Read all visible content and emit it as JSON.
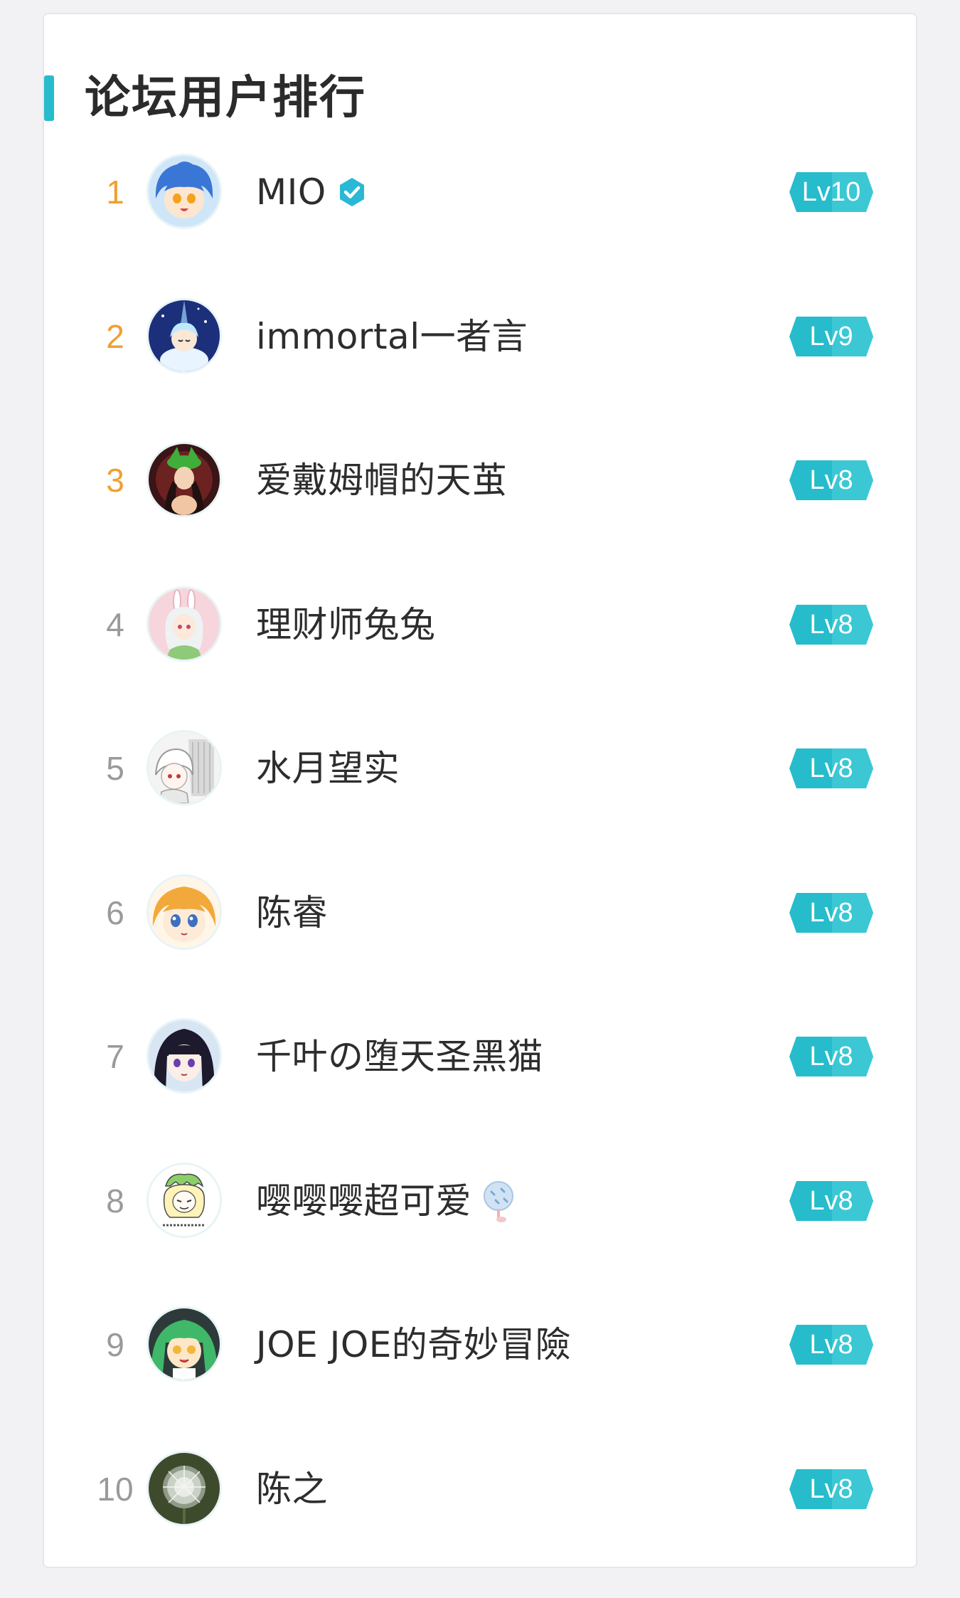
{
  "panel": {
    "title": "论坛用户排行"
  },
  "colors": {
    "accent": "#26bccc",
    "top_rank": "#f0a030",
    "normal_rank": "#9a9a9a",
    "level_badge": "#26bccc"
  },
  "users": [
    {
      "rank": "1",
      "name": "MIO",
      "level": "Lv10",
      "verified": true,
      "avatar_icon": "avatar-blue-hair-icon"
    },
    {
      "rank": "2",
      "name": "immortal一者言",
      "level": "Lv9",
      "avatar_icon": "avatar-starry-girl-icon"
    },
    {
      "rank": "3",
      "name": "爱戴姆帽的天茧",
      "level": "Lv8",
      "avatar_icon": "avatar-dark-girl-icon"
    },
    {
      "rank": "4",
      "name": "理财师兔兔",
      "level": "Lv8",
      "avatar_icon": "avatar-bunny-girl-icon"
    },
    {
      "rank": "5",
      "name": "水月望实",
      "level": "Lv8",
      "avatar_icon": "avatar-white-hair-icon"
    },
    {
      "rank": "6",
      "name": "陈睿",
      "level": "Lv8",
      "avatar_icon": "avatar-blonde-girl-icon"
    },
    {
      "rank": "7",
      "name": "千叶の堕天圣黑猫",
      "level": "Lv8",
      "avatar_icon": "avatar-black-hair-icon"
    },
    {
      "rank": "8",
      "name": "嘤嘤嘤超可爱",
      "level": "Lv8",
      "emoji": "fan-emoji-icon",
      "avatar_icon": "avatar-sketch-girl-icon"
    },
    {
      "rank": "9",
      "name": "JOE JOE的奇妙冒險",
      "level": "Lv8",
      "avatar_icon": "avatar-green-hair-icon"
    },
    {
      "rank": "10",
      "name": "陈之",
      "level": "Lv8",
      "avatar_icon": "avatar-dandelion-icon"
    }
  ]
}
